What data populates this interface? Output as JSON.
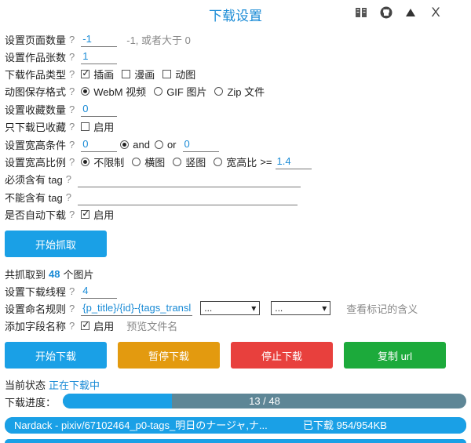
{
  "header": {
    "title": "下载设置",
    "icons": [
      "book-icon",
      "github-icon",
      "triangle-up-icon"
    ],
    "close_label": "X"
  },
  "settings": {
    "page_count": {
      "label": "设置页面数量",
      "help": "?",
      "value": "-1",
      "hint": "-1, 或者大于 0"
    },
    "work_count": {
      "label": "设置作品张数",
      "help": "?",
      "value": "1"
    },
    "work_type": {
      "label": "下载作品类型",
      "help": "?",
      "options": [
        {
          "label": "插画",
          "checked": true
        },
        {
          "label": "漫画",
          "checked": false
        },
        {
          "label": "动图",
          "checked": false
        }
      ]
    },
    "ugoira_format": {
      "label": "动图保存格式",
      "help": "?",
      "options": [
        {
          "label": "WebM 视频",
          "checked": true
        },
        {
          "label": "GIF 图片",
          "checked": false
        },
        {
          "label": "Zip 文件",
          "checked": false
        }
      ]
    },
    "bookmark_count": {
      "label": "设置收藏数量",
      "help": "?",
      "value": "0"
    },
    "only_bookmarked": {
      "label": "只下载已收藏",
      "help": "?",
      "option": "启用",
      "checked": false
    },
    "size_condition": {
      "label": "设置宽高条件",
      "help": "?",
      "width": "0",
      "and_label": "and",
      "or_label": "or",
      "height": "0",
      "and_checked": true
    },
    "ratio": {
      "label": "设置宽高比例",
      "help": "?",
      "options": [
        {
          "label": "不限制",
          "checked": true
        },
        {
          "label": "横图",
          "checked": false
        },
        {
          "label": "竖图",
          "checked": false
        },
        {
          "label": "宽高比",
          "checked": false
        }
      ],
      "gte": ">=",
      "value": "1.4"
    },
    "must_tag": {
      "label": "必须含有 tag",
      "help": "?",
      "value": ""
    },
    "not_tag": {
      "label": "不能含有 tag",
      "help": "?",
      "value": ""
    },
    "auto_download": {
      "label": "是否自动下载",
      "help": "?",
      "option": "启用",
      "checked": true
    }
  },
  "crawl_button": "开始抓取",
  "summary": {
    "prefix": "共抓取到",
    "count": "48",
    "suffix": "个图片"
  },
  "threads": {
    "label": "设置下载线程",
    "help": "?",
    "value": "4"
  },
  "naming": {
    "label": "设置命名规则",
    "help": "?",
    "value": "{p_title}/{id}-{tags_transl}",
    "select1": "...",
    "select2": "...",
    "link": "查看标记的含义"
  },
  "field_names": {
    "label": "添加字段名称",
    "help": "?",
    "option": "启用",
    "checked": true,
    "preview": "预览文件名"
  },
  "actions": [
    {
      "label": "开始下载",
      "color": "#1aa0e6"
    },
    {
      "label": "暂停下载",
      "color": "#e39a0f"
    },
    {
      "label": "停止下载",
      "color": "#e8403d"
    },
    {
      "label": "复制 url",
      "color": "#1caa3b"
    }
  ],
  "status": {
    "label": "当前状态",
    "value": "正在下载中"
  },
  "progress": {
    "label": "下载进度：",
    "text": "13 / 48",
    "fraction": 0.27
  },
  "file_progress": {
    "name": "Nardack - pixiv/67102464_p0-tags_明日のナージャ,ナ...",
    "status": "已下载  954/954KB",
    "fraction": 1.0
  },
  "colors": {
    "accent": "#1a8bd6",
    "track": "#5e8696",
    "bar": "#1aa0e6"
  }
}
